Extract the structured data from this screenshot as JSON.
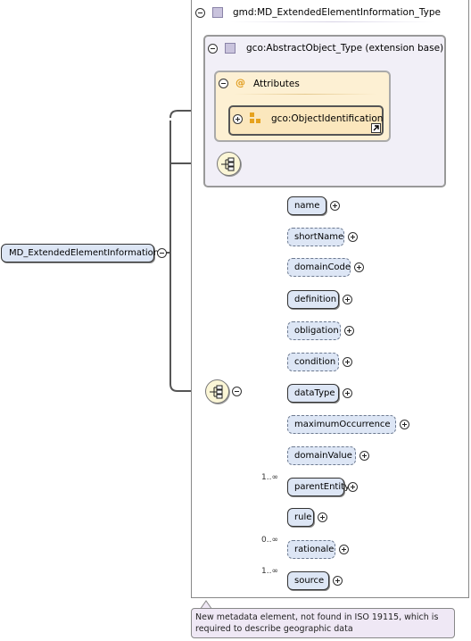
{
  "root_element": {
    "label": "MD_ExtendedElementInformation"
  },
  "type_box": {
    "label": "gmd:MD_ExtendedElementInformation_Type"
  },
  "base_box": {
    "label": "gco:AbstractObject_Type (extension base)"
  },
  "attributes_box": {
    "label": "Attributes",
    "attribute_group": {
      "label": "gco:ObjectIdentification"
    }
  },
  "elements": [
    {
      "label": "name",
      "required": true,
      "cardinality": ""
    },
    {
      "label": "shortName",
      "required": false,
      "cardinality": ""
    },
    {
      "label": "domainCode",
      "required": false,
      "cardinality": ""
    },
    {
      "label": "definition",
      "required": true,
      "cardinality": ""
    },
    {
      "label": "obligation",
      "required": false,
      "cardinality": ""
    },
    {
      "label": "condition",
      "required": false,
      "cardinality": ""
    },
    {
      "label": "dataType",
      "required": true,
      "cardinality": ""
    },
    {
      "label": "maximumOccurrence",
      "required": false,
      "cardinality": ""
    },
    {
      "label": "domainValue",
      "required": false,
      "cardinality": ""
    },
    {
      "label": "parentEntity",
      "required": true,
      "cardinality": "1..∞"
    },
    {
      "label": "rule",
      "required": true,
      "cardinality": ""
    },
    {
      "label": "rationale",
      "required": false,
      "cardinality": "0..∞"
    },
    {
      "label": "source",
      "required": true,
      "cardinality": "1..∞"
    }
  ],
  "annotation": {
    "text": "New metadata element, not found in ISO 19115, which is required to describe geographic data"
  }
}
